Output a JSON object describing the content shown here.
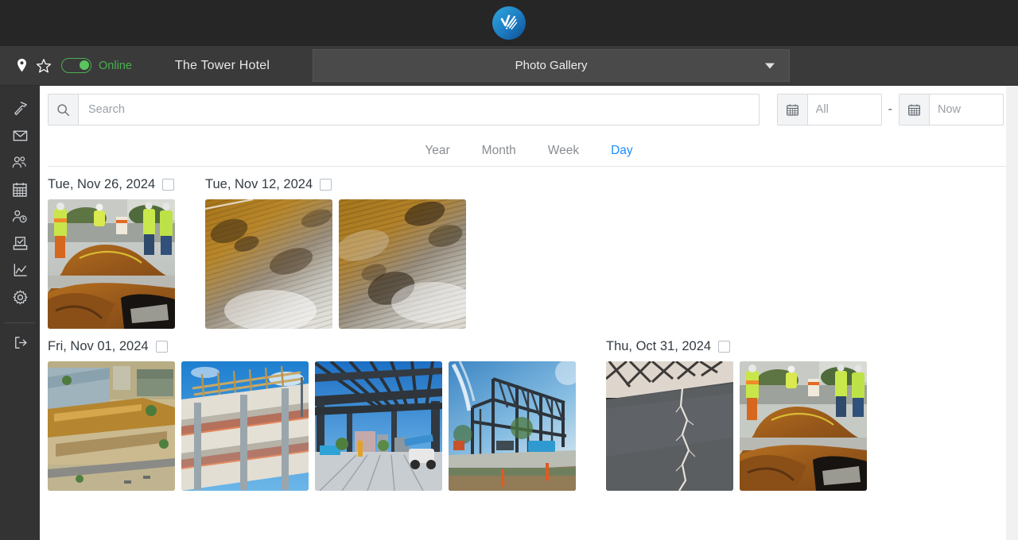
{
  "topbar": {
    "logo_icon": "velocity-check-logo-icon"
  },
  "sitebar": {
    "pin_icon": "map-pin-icon",
    "star_icon": "star-icon",
    "status_toggle_icon": "online-toggle",
    "status_label": "Online",
    "site_name": "The Tower Hotel",
    "gallery_select_value": "Photo Gallery",
    "gallery_select_caret_icon": "chevron-down-icon"
  },
  "sidebar": {
    "items": [
      {
        "label": "Tools",
        "icon": "hammer-icon"
      },
      {
        "label": "Messages",
        "icon": "envelope-icon"
      },
      {
        "label": "Team",
        "icon": "people-group-icon"
      },
      {
        "label": "Calendar",
        "icon": "calendar-icon"
      },
      {
        "label": "Time Tracking",
        "icon": "person-clock-icon"
      },
      {
        "label": "Checklists",
        "icon": "ballot-box-icon"
      },
      {
        "label": "Reports",
        "icon": "line-chart-icon"
      },
      {
        "label": "Settings",
        "icon": "gear-icon"
      }
    ],
    "logout": {
      "label": "Log Out",
      "icon": "logout-arrow-icon"
    }
  },
  "filters": {
    "search_icon": "search-icon",
    "search_value": "",
    "search_placeholder": "Search",
    "date_from_icon": "calendar-icon",
    "date_from_value": "",
    "date_from_placeholder": "All",
    "range_separator": "-",
    "date_to_icon": "calendar-icon",
    "date_to_value": "",
    "date_to_placeholder": "Now"
  },
  "tabs": [
    {
      "label": "Year",
      "active": false
    },
    {
      "label": "Month",
      "active": false
    },
    {
      "label": "Week",
      "active": false
    },
    {
      "label": "Day",
      "active": true
    }
  ],
  "colors": {
    "accent_blue": "#1a8cff",
    "online_green": "#4caf50",
    "topbar_dark": "#262626",
    "sitebar_dark": "#3a3a3a",
    "sidebar_dark": "#333333"
  },
  "gallery": {
    "rows": [
      {
        "groups": [
          {
            "date_label": "Tue, Nov 26, 2024",
            "checked": false,
            "photos": [
              {
                "alt": "excavation site with workers and dirt mound",
                "kind": "excavation"
              }
            ]
          },
          {
            "date_label": "Tue, Nov 12, 2024",
            "checked": false,
            "photos": [
              {
                "alt": "hardwood floor closeup with dark stains",
                "kind": "wood-floor-a"
              },
              {
                "alt": "hardwood floor closeup with glare",
                "kind": "wood-floor-b"
              }
            ]
          }
        ]
      },
      {
        "groups": [
          {
            "date_label": "Fri, Nov 01, 2024",
            "checked": false,
            "photos": [
              {
                "alt": "aerial view of construction site",
                "kind": "aerial-site"
              },
              {
                "alt": "concrete building frame with orange netting",
                "kind": "concrete-frame"
              },
              {
                "alt": "steel roof framing interior with lifts",
                "kind": "steel-interior"
              },
              {
                "alt": "steel structure exterior against blue sky",
                "kind": "steel-exterior"
              }
            ]
          },
          {
            "date_label": "Thu, Oct 31, 2024",
            "checked": false,
            "photos": [
              {
                "alt": "cracked concrete slab with tile wall",
                "kind": "cracked-slab"
              },
              {
                "alt": "excavation site with workers and dirt mound",
                "kind": "excavation"
              }
            ]
          }
        ]
      }
    ]
  }
}
